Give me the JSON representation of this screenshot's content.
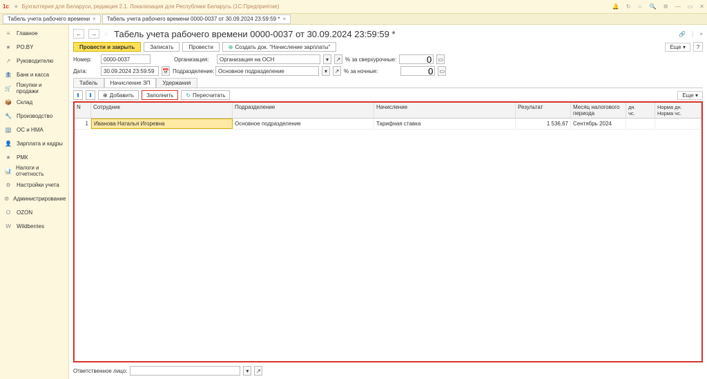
{
  "app": {
    "title": "Бухгалтерия для Беларуси, редакция 2.1. Локализация для Республики Беларусь  (1С:Предприятие)"
  },
  "tabs": {
    "t1": "Табель учета рабочего времени",
    "t2": "Табель учета рабочего времени 0000-0037 от 30.09.2024 23:59:59 *"
  },
  "sidebar": {
    "items": [
      {
        "icon": "≡",
        "label": "Главное"
      },
      {
        "icon": "★",
        "label": "PO.BY"
      },
      {
        "icon": "↗",
        "label": "Руководителю"
      },
      {
        "icon": "🏦",
        "label": "Банк и касса"
      },
      {
        "icon": "🛒",
        "label": "Покупки и продажи"
      },
      {
        "icon": "📦",
        "label": "Склад"
      },
      {
        "icon": "🔧",
        "label": "Производство"
      },
      {
        "icon": "🏢",
        "label": "ОС и НМА"
      },
      {
        "icon": "👤",
        "label": "Зарплата и кадры"
      },
      {
        "icon": "★",
        "label": "РМК"
      },
      {
        "icon": "📊",
        "label": "Налоги и отчетность"
      },
      {
        "icon": "⚙",
        "label": "Настройки учета"
      },
      {
        "icon": "⚙",
        "label": "Администрирование"
      },
      {
        "icon": "O",
        "label": "OZON"
      },
      {
        "icon": "W",
        "label": "Wildberries"
      }
    ]
  },
  "doc": {
    "title": "Табель учета рабочего времени 0000-0037 от 30.09.2024 23:59:59 *",
    "actions": {
      "post_close": "Провести и закрыть",
      "write": "Записать",
      "post": "Провести",
      "create_payroll": "Создать док. \"Начисление зарплаты\"",
      "more": "Еще"
    },
    "fields": {
      "number_lbl": "Номер:",
      "number": "0000-0037",
      "date_lbl": "Дата:",
      "date": "30.09.2024 23:59:59",
      "org_lbl": "Организация:",
      "org": "Организация на ОСН",
      "dept_lbl": "Подразделение:",
      "dept": "Основное подразделение",
      "overtime_lbl": "% за сверхурочные:",
      "overtime": "0",
      "night_lbl": "% за ночные:",
      "night": "0"
    },
    "doctabs": {
      "t1": "Табель",
      "t2": "Начисление ЗП",
      "t3": "Удержания"
    },
    "tablebar": {
      "add": "Добавить",
      "fill": "Заполнить",
      "recalc": "Пересчитать",
      "more": "Еще"
    },
    "columns": {
      "n": "N",
      "emp": "Сотрудник",
      "dept": "Подразделение",
      "accr": "Начисление",
      "result": "Результат",
      "period": "Месяц налогового периода",
      "dn": "дн.",
      "norm_dn": "Норма дн.",
      "hs": "чс.",
      "norm_hs": "Норма чс."
    },
    "row": {
      "n": "1",
      "emp": "Иванова Наталья Игоревна",
      "dept": "Основное подразделение",
      "accr": "Тарифная ставка",
      "result": "1 536,67",
      "period": "Сентябрь 2024"
    },
    "footer_lbl": "Ответственное лицо:"
  }
}
